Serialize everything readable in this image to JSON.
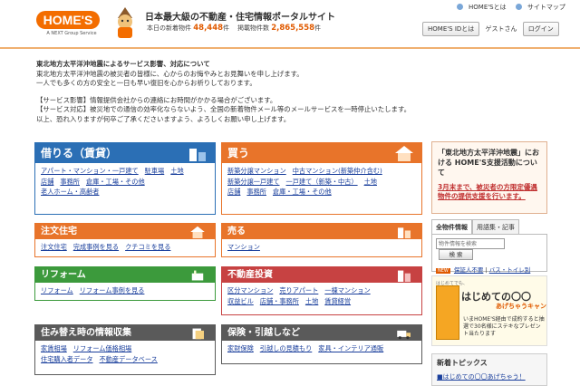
{
  "header": {
    "logo": "HOME'S",
    "logo_sub": "A NEXT Group Service",
    "tagline": "日本最大級の不動産・住宅情報ポータルサイト",
    "new_label": "本日の新着物件",
    "new_count": "48,448",
    "new_unit": "件",
    "listed_label": "掲載物件数",
    "listed_count": "2,865,558",
    "listed_unit": "件",
    "link_about": "HOME'Sとは",
    "link_sitemap": "サイトマップ",
    "myhomes": "HOME'S IDとは",
    "guest": "ゲストさん",
    "login": "ログイン"
  },
  "notice": {
    "title": "東北地方太平洋沖地震によるサービス影響、対応について",
    "line1": "東北地方太平洋沖地震の被災者の皆様に、心からのお悔やみとお見舞いを申し上げます。",
    "line2": "一人でも多くの方の安全と一日も早い復旧を心からお祈りしております。",
    "line3": "【サービス影響】情報提供会社からの連絡にお時間がかかる場合がございます。",
    "line4": "【サービス対応】被災地での通信の効率化ならないよう、全国の新着物件メール等のメールサービスを一時停止いたします。",
    "line5": "以上、恐れ入りますが何卒ご了承くださいますよう、よろしくお願い申し上げます。"
  },
  "cats": {
    "rent": {
      "title": "借りる（賃貸）",
      "links": [
        "アパート・マンション・一戸建て",
        "駐車場",
        "土地",
        "店舗",
        "事務所",
        "倉庫・工場・その他",
        "老人ホーム・高齢者"
      ]
    },
    "buy": {
      "title": "買う",
      "links": [
        "新築分譲マンション",
        "中古マンション(新築仲介含む)",
        "新築分譲一戸建て",
        "一戸建て（新築・中古）",
        "土地",
        "店舗",
        "事務所",
        "倉庫・工場・その他"
      ]
    },
    "order": {
      "title": "注文住宅",
      "links": [
        "注文住宅",
        "完成事例を見る",
        "クチコミを見る"
      ]
    },
    "sell": {
      "title": "売る",
      "links": [
        "マンション"
      ]
    },
    "reform": {
      "title": "リフォーム",
      "links": [
        "リフォーム",
        "リフォーム事例を見る"
      ]
    },
    "invest": {
      "title": "不動産投資",
      "links": [
        "区分マンション",
        "売りアパート",
        "一棟マンション",
        "収益ビル",
        "店舗・事務所",
        "土地",
        "賃貸経営"
      ]
    },
    "info": {
      "title": "住み替え時の情報収集",
      "links": [
        "家賃相場",
        "リフォーム価格相場",
        "住宅購入者データ",
        "不動産データベース"
      ]
    },
    "insurance": {
      "title": "保険・引越しなど",
      "links": [
        "家財保険",
        "引越しの見積もり",
        "家具・インテリア通販"
      ]
    }
  },
  "sidebar": {
    "quake_title": "「東北地方太平洋沖地震」における HOME'S支援活動について",
    "quake_link": "3月末まで、被災者の方限定優遇物件の提供支援を行います。",
    "tab1": "全物件情報",
    "tab2": "用語集・記事",
    "search_placeholder": "物件情報を検索",
    "search_button": "検 索",
    "new": "NEW",
    "search_link1": "保証人不要",
    "search_link2": "バス・トイレ別",
    "banner_small": "はじめてでも、",
    "banner_title": "はじめての〇〇",
    "banner_sub": "あげちゃうキャン",
    "banner_text": "いまHOME'S経由で成約すると抽選で30名様にステキなプレゼント当たります",
    "topics_title": "新着トピックス",
    "topics_item": "■はじめての〇〇あげちゃう！"
  }
}
